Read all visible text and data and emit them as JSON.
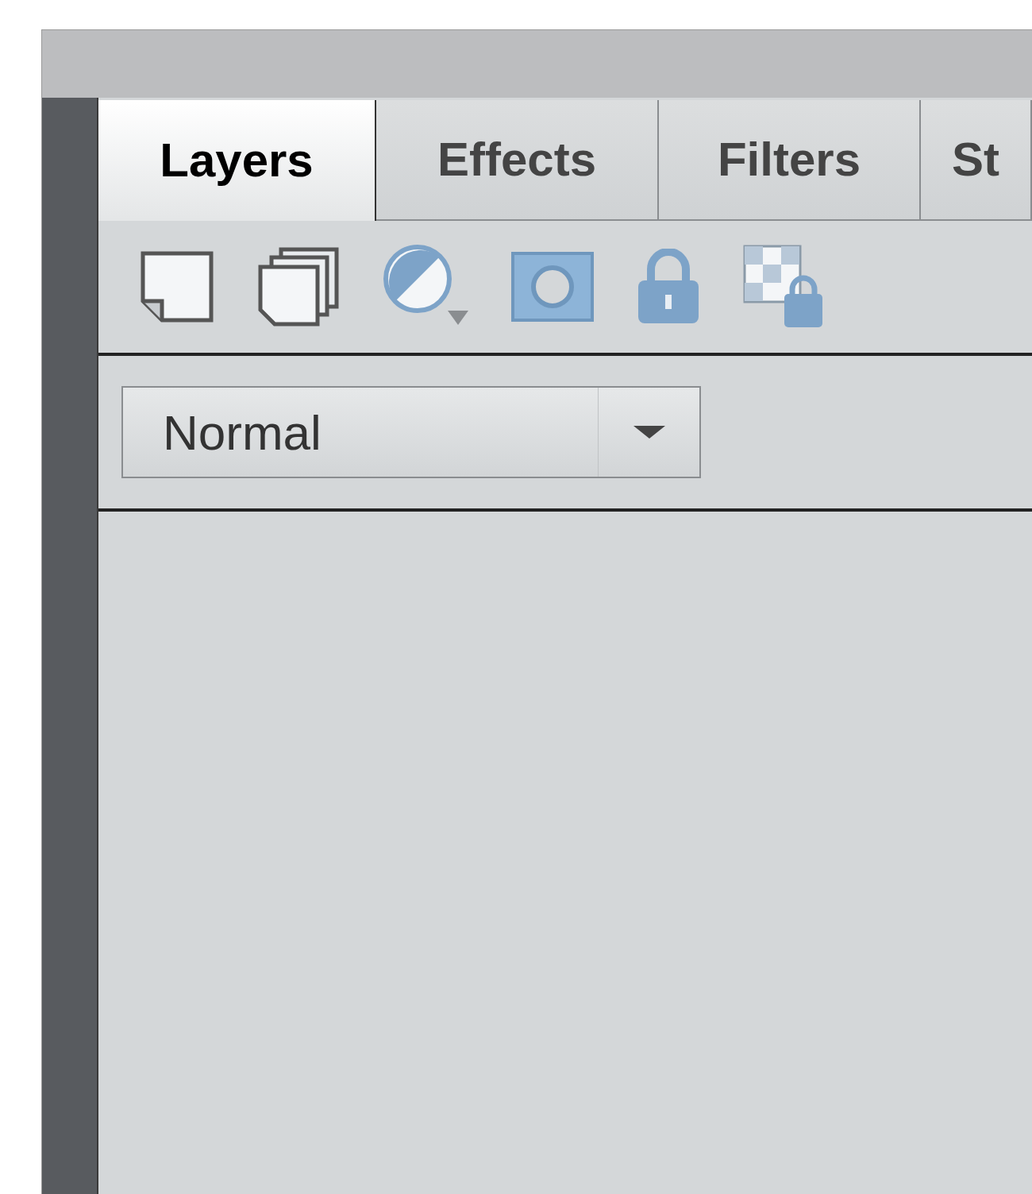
{
  "tabs": [
    {
      "label": "Layers",
      "selected": true
    },
    {
      "label": "Effects",
      "selected": false
    },
    {
      "label": "Filters",
      "selected": false
    },
    {
      "label": "St",
      "selected": false
    }
  ],
  "blend_mode": {
    "value": "Normal"
  }
}
